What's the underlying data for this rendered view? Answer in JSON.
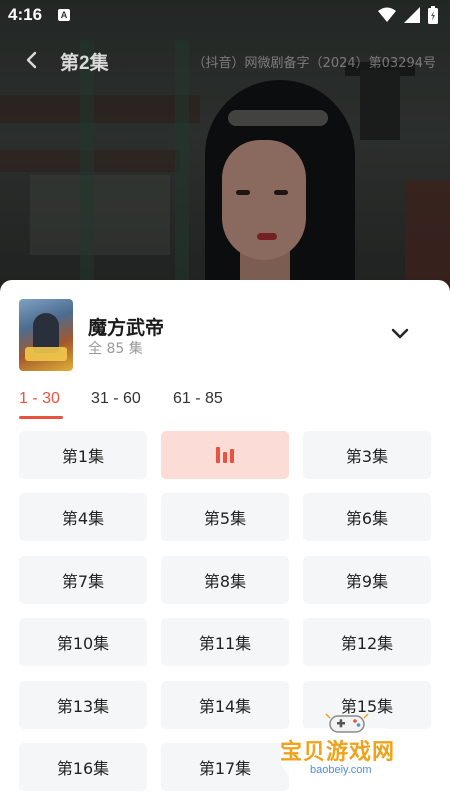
{
  "status_bar": {
    "time": "4:16",
    "a_icon": "A"
  },
  "header": {
    "title": "第2集",
    "license": "（抖音）网微剧备字（2024）第03294号"
  },
  "show": {
    "title": "魔方武帝",
    "episode_count": "全 85 集"
  },
  "range_tabs": [
    {
      "label": "1 - 30",
      "active": true
    },
    {
      "label": "31 - 60",
      "active": false
    },
    {
      "label": "61 - 85",
      "active": false
    }
  ],
  "episodes": [
    {
      "label": "第1集",
      "playing": false
    },
    {
      "label": "",
      "playing": true
    },
    {
      "label": "第3集",
      "playing": false
    },
    {
      "label": "第4集",
      "playing": false
    },
    {
      "label": "第5集",
      "playing": false
    },
    {
      "label": "第6集",
      "playing": false
    },
    {
      "label": "第7集",
      "playing": false
    },
    {
      "label": "第8集",
      "playing": false
    },
    {
      "label": "第9集",
      "playing": false
    },
    {
      "label": "第10集",
      "playing": false
    },
    {
      "label": "第11集",
      "playing": false
    },
    {
      "label": "第12集",
      "playing": false
    },
    {
      "label": "第13集",
      "playing": false
    },
    {
      "label": "第14集",
      "playing": false
    },
    {
      "label": "第15集",
      "playing": false
    },
    {
      "label": "第16集",
      "playing": false
    },
    {
      "label": "第17集",
      "playing": false
    }
  ],
  "watermark": {
    "text": "宝贝游戏网",
    "url": "baobeiy.com"
  },
  "colors": {
    "accent": "#e8523f",
    "playing_bg": "#fcdcd6",
    "button_bg": "#f5f6f7"
  }
}
